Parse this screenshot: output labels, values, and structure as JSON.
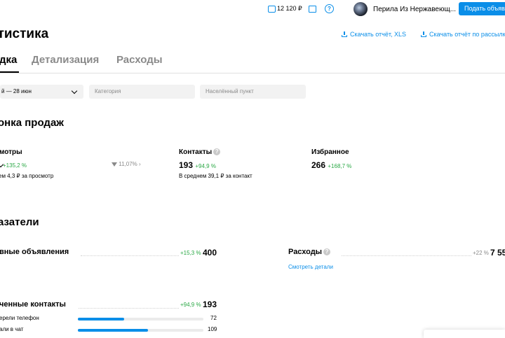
{
  "header": {
    "balance": "12 120 ₽",
    "help_icon": "?",
    "username": "Перила Из Нержавеющ...",
    "post_ad_label": "Подать объявл"
  },
  "page": {
    "title": "атистика",
    "download_xls": "Скачать отчёт, XLS",
    "download_mailing": "Скачать отчёт по рассылк"
  },
  "tabs": [
    {
      "label": "дка",
      "active": true
    },
    {
      "label": "Детализация",
      "active": false
    },
    {
      "label": "Расходы",
      "active": false
    }
  ],
  "filters": {
    "date_range": "й — 28 июн",
    "category_placeholder": "Категория",
    "city_placeholder": "Населённый пункт"
  },
  "sales_funnel": {
    "title": "онка продаж",
    "views": {
      "label": "мотры",
      "change": "+135,2 %",
      "note": "ем 4,3 ₽ за просмотр",
      "conversion": "11,07%"
    },
    "contacts": {
      "label": "Контакты",
      "value": "193",
      "change": "+94,9 %",
      "note": "В среднем 39,1 ₽ за контакт"
    },
    "favorites": {
      "label": "Избранное",
      "value": "266",
      "change": "+168,7 %"
    }
  },
  "indicators": {
    "title": "азатели",
    "active_ads": {
      "label": "вные объявления",
      "change": "+15,3 %",
      "value": "400"
    },
    "expenses": {
      "label": "Расходы",
      "change": "+22 %",
      "value": "7 55",
      "link": "Смотреть детали"
    },
    "received_contacts": {
      "label": "ченные контакты",
      "change": "+94,9 %",
      "value": "193",
      "rows": [
        {
          "label": "ерели телефон",
          "value": "72",
          "fraction": 0.37
        },
        {
          "label": "али в чат",
          "value": "109",
          "fraction": 0.56
        }
      ]
    }
  },
  "colors": {
    "accent": "#0a8ee8",
    "positive": "#2aa845",
    "muted": "#8a8a8a"
  }
}
